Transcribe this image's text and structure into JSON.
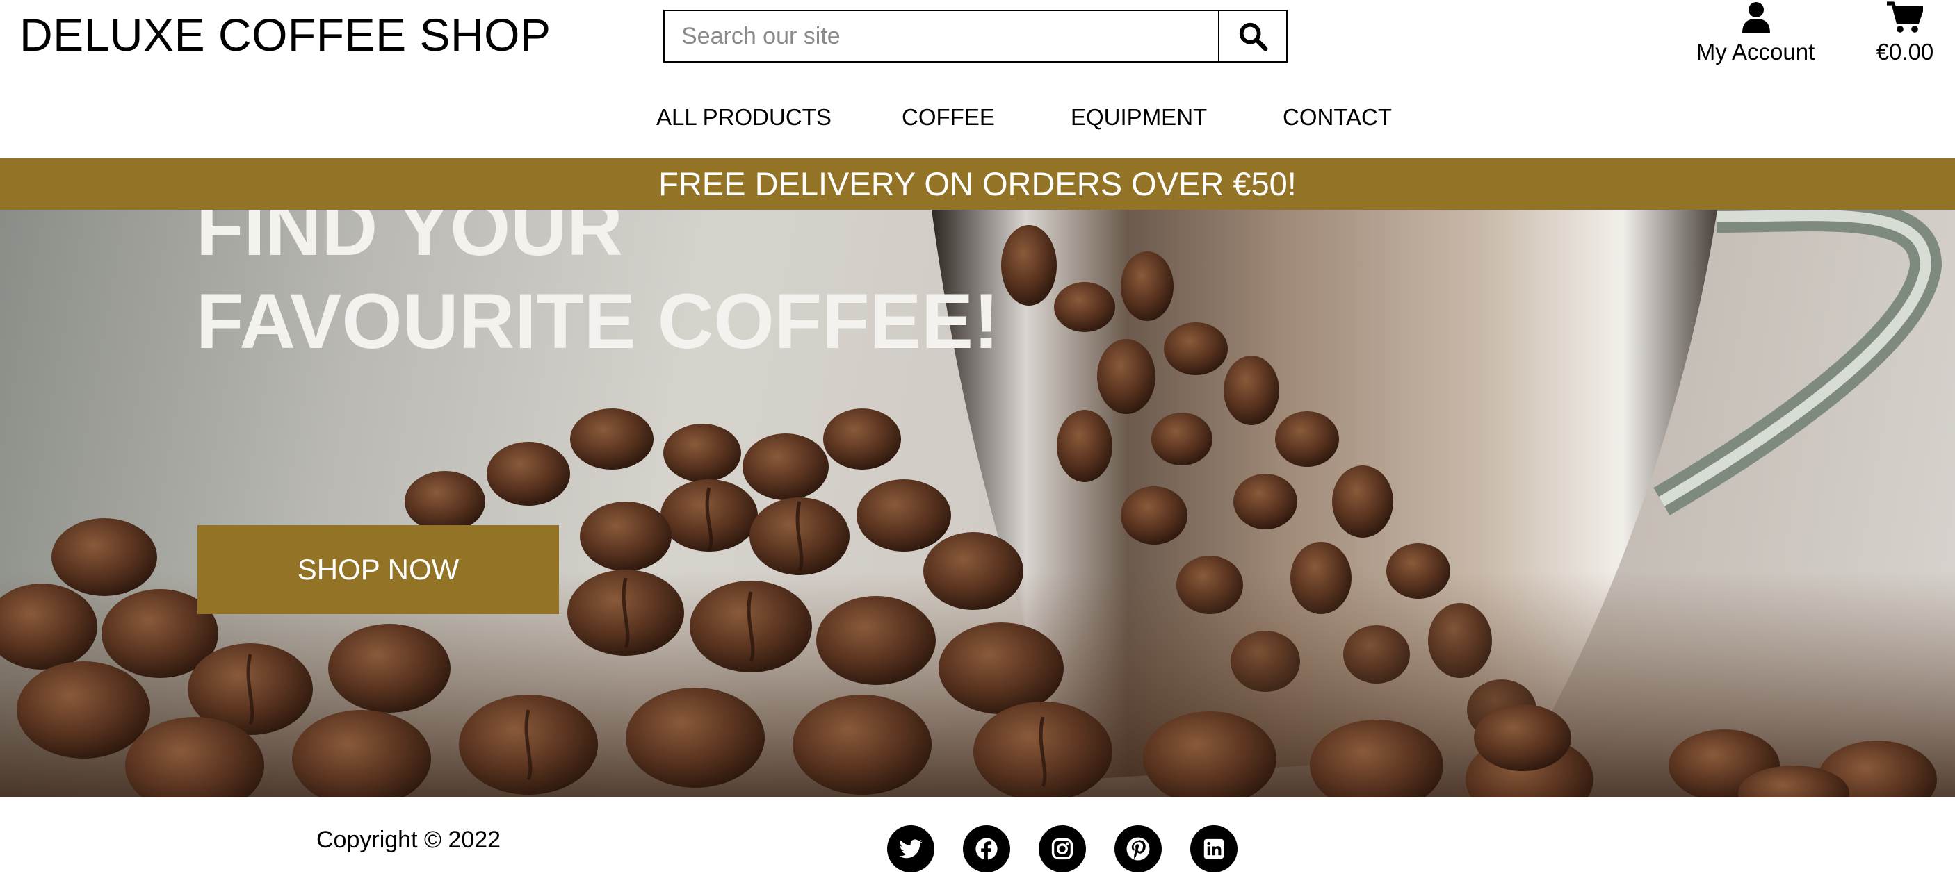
{
  "header": {
    "brand": "DELUXE COFFEE SHOP",
    "search": {
      "placeholder": "Search our site",
      "value": "",
      "icon": "search-icon"
    },
    "account": {
      "label": "My Account",
      "icon": "user-icon"
    },
    "cart": {
      "total": "€0.00",
      "icon": "shopping-cart-icon"
    }
  },
  "nav": {
    "items": [
      {
        "label": "ALL PRODUCTS"
      },
      {
        "label": "COFFEE"
      },
      {
        "label": "EQUIPMENT"
      },
      {
        "label": "CONTACT"
      }
    ]
  },
  "banner": {
    "text": "FREE DELIVERY ON ORDERS OVER €50!"
  },
  "hero": {
    "title_line1": "FIND YOUR",
    "title_line2": "FAVOURITE COFFEE!",
    "cta_label": "SHOP NOW"
  },
  "footer": {
    "copyright": "Copyright © 2022",
    "social": [
      "twitter-icon",
      "facebook-icon",
      "instagram-icon",
      "pinterest-icon",
      "linkedin-icon"
    ]
  },
  "colors": {
    "accent": "#937426",
    "text": "#000000",
    "background": "#ffffff"
  }
}
